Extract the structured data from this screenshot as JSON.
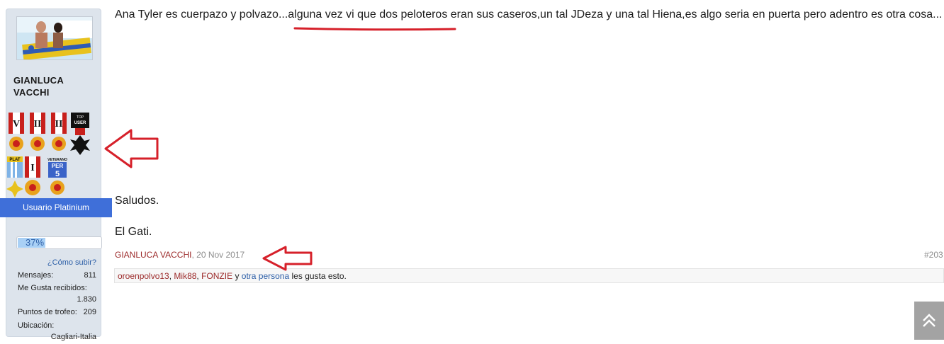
{
  "user": {
    "name": "GIANLUCA VACCHI",
    "rank": "Usuario Platinium",
    "progress_text": "37%",
    "progress_fraction": 0.37,
    "how_link": "¿Cómo subir?",
    "stats": [
      {
        "label": "Mensajes:",
        "value": "811"
      },
      {
        "label": "Me Gusta recibidos:",
        "value": "1.830"
      },
      {
        "label": "Puntos de trofeo:",
        "value": "209"
      },
      {
        "label": "Ubicación:",
        "value": "Cagliari-Italia"
      }
    ],
    "medal_labels": {
      "top_user": "TOP USER",
      "plat": "PLAT",
      "veterano": "VETERANO",
      "per": "PER",
      "per_num": "5"
    }
  },
  "post": {
    "body": "Ana Tyler es cuerpazo y polvazo...alguna vez vi que dos peloteros eran sus caseros,un tal JDeza y una tal Hiena,es algo seria en puerta pero adentro es otra cosa...",
    "greeting": "Saludos.",
    "signature": "El Gati.",
    "author": "GIANLUCA VACCHI",
    "date": "20 Nov 2017",
    "post_number": "#203",
    "likes": {
      "users": [
        "oroenpolvo13",
        "Mik88",
        "FONZIE"
      ],
      "connector": "y",
      "other": "otra persona",
      "suffix": "les gusta esto."
    }
  },
  "colors": {
    "sidebar": "#dde4ec",
    "rank_banner": "#3f6fd9",
    "link_blue": "#2b5ea7",
    "user_red": "#9c2a2a",
    "annotation_red": "#d6202a"
  },
  "icons": {
    "scroll_top": "double-chevron-up-icon",
    "arrow_left": "arrow-left-icon"
  }
}
